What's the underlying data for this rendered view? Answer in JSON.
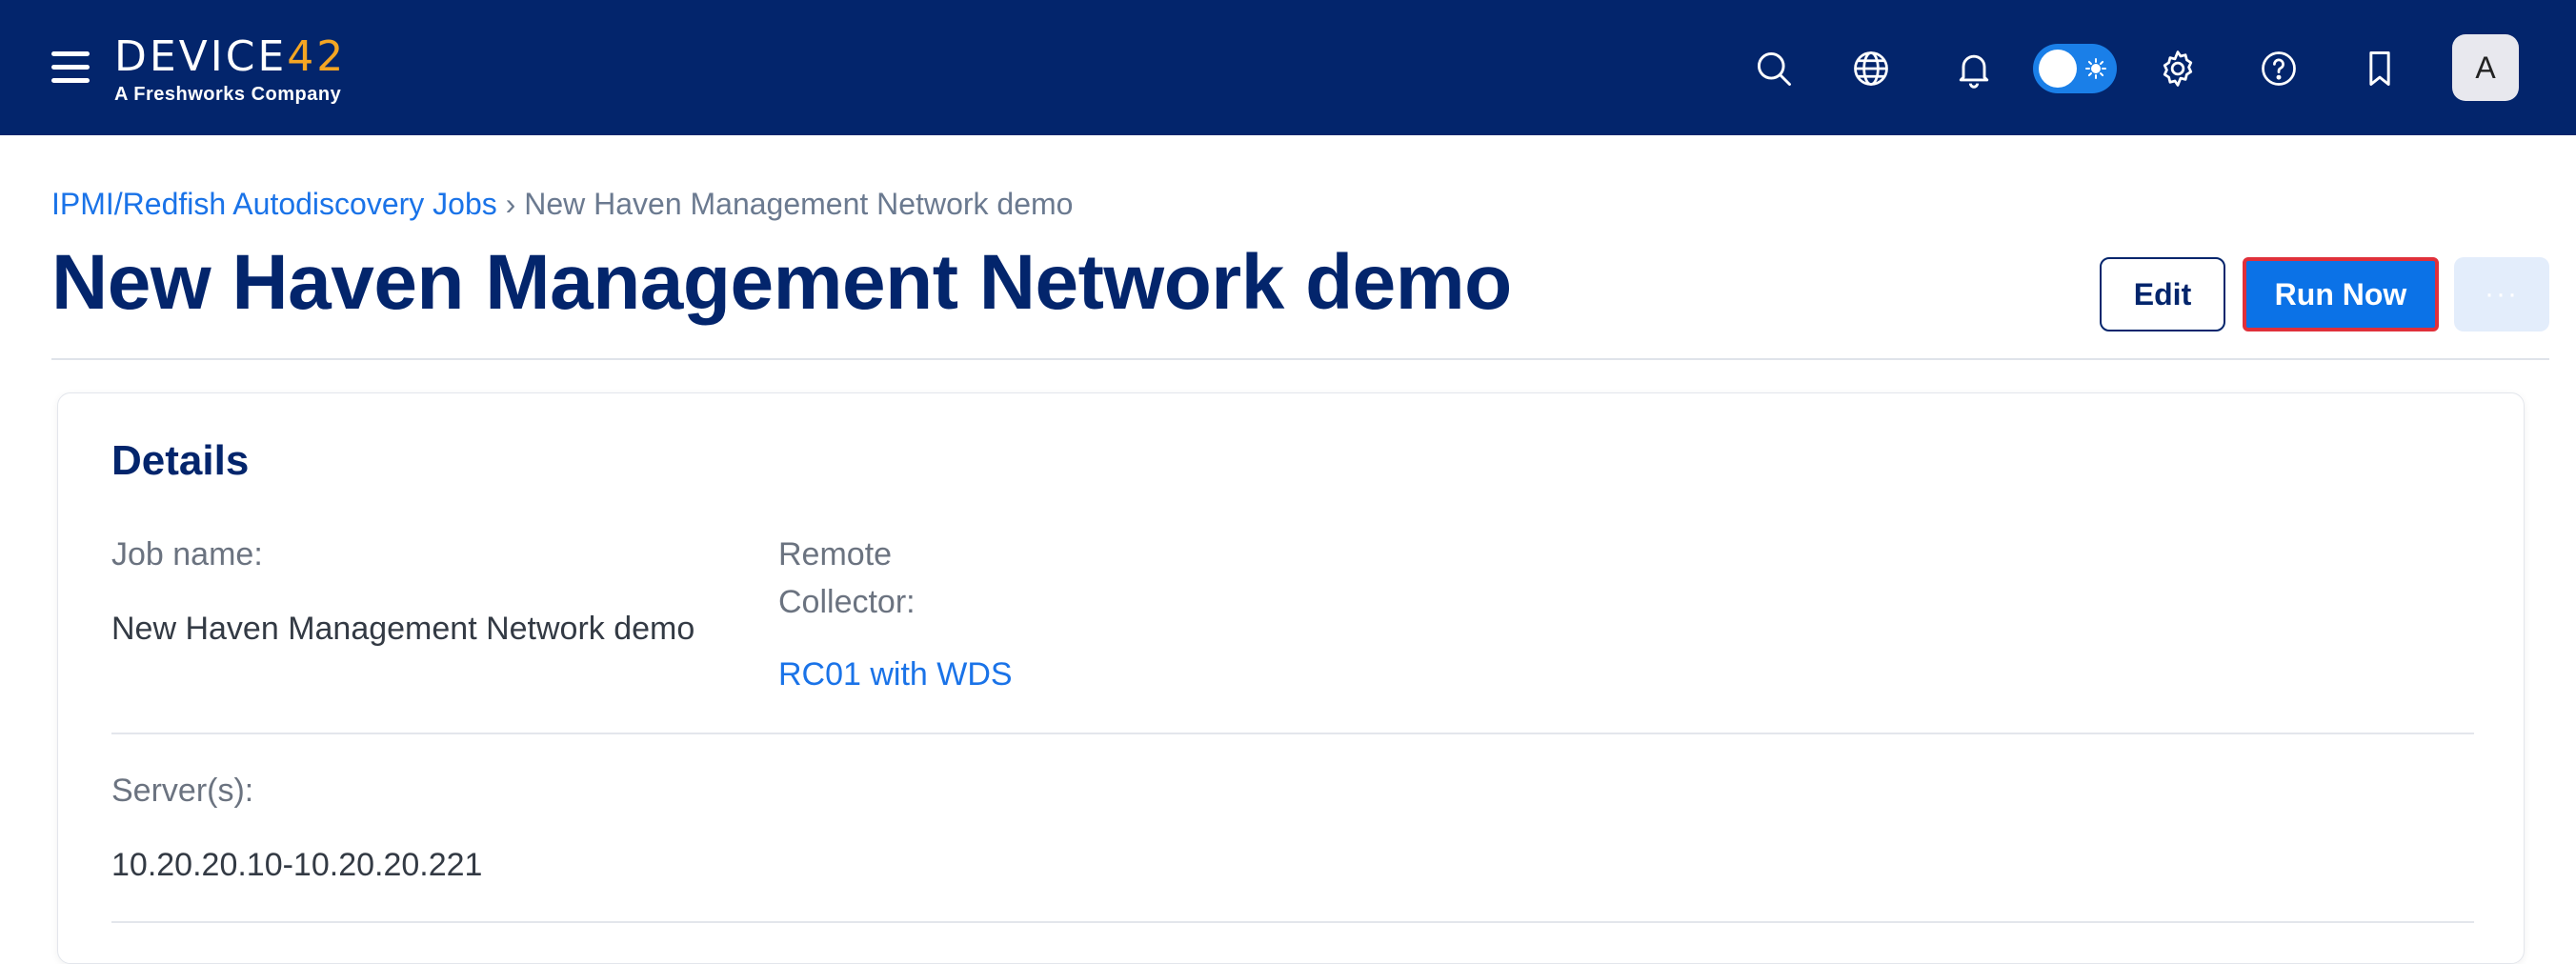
{
  "header": {
    "logo_text_main": "DEVICE",
    "logo_text_accent": "42",
    "logo_subtext": "A Freshworks Company",
    "icons": [
      "menu-icon",
      "search-icon",
      "globe-icon",
      "bell-icon",
      "theme-toggle",
      "gear-icon",
      "help-icon",
      "bookmark-icon"
    ],
    "avatar_initial": "A",
    "colors": {
      "bar": "#03256c",
      "accent": "#f5a623",
      "toggle": "#1a7fe8"
    }
  },
  "breadcrumb": {
    "parent": "IPMI/Redfish Autodiscovery Jobs",
    "separator": "›",
    "current": "New Haven Management Network demo"
  },
  "page": {
    "title": "New Haven Management Network demo",
    "edit_label": "Edit",
    "run_label": "Run Now",
    "more_label": "···"
  },
  "details": {
    "title": "Details",
    "job_name_label": "Job name:",
    "job_name_value": "New Haven Management Network demo",
    "remote_collector_label_line1": "Remote",
    "remote_collector_label_line2": "Collector:",
    "remote_collector_value": "RC01 with WDS",
    "servers_label": "Server(s):",
    "servers_value": "10.20.20.10-10.20.20.221"
  }
}
